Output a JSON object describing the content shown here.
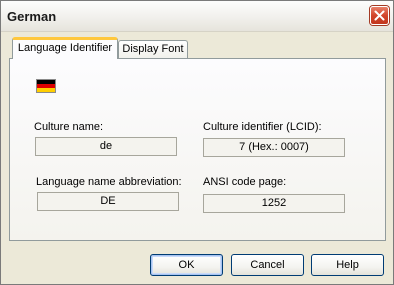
{
  "window": {
    "title": "German"
  },
  "tabs": [
    {
      "label": "Language Identifier",
      "active": true
    },
    {
      "label": "Display Font",
      "active": false
    }
  ],
  "flag": {
    "icon": "germany-flag-icon",
    "colors": [
      "#000000",
      "#dd0000",
      "#ffce00"
    ]
  },
  "fields": {
    "culture_name": {
      "label": "Culture name:",
      "value": "de"
    },
    "lcid": {
      "label": "Culture identifier (LCID):",
      "value": "7  (Hex.: 0007)"
    },
    "abbreviation": {
      "label": "Language name abbreviation:",
      "value": "DE"
    },
    "ansi_code_page": {
      "label": "ANSI code page:",
      "value": "1252"
    }
  },
  "buttons": {
    "ok": "OK",
    "cancel": "Cancel",
    "help": "Help"
  },
  "colors": {
    "accent_tab": "#ffc83c",
    "close_button": "#d2452b",
    "button_border": "#003c74"
  }
}
